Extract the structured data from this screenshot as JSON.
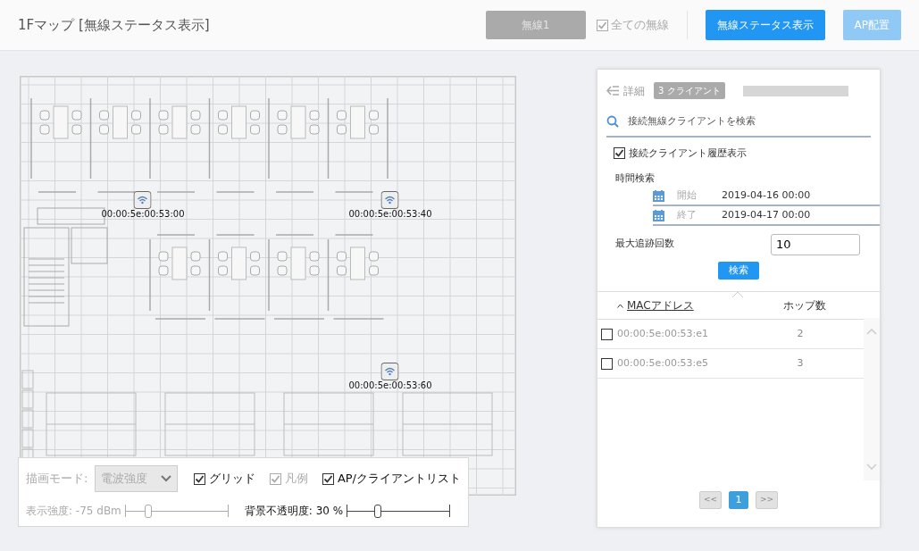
{
  "header": {
    "title": "1Fマップ [無線ステータス表示]",
    "radio_select": {
      "label": "無線1",
      "disabled": true
    },
    "all_radios": {
      "label": "全ての無線",
      "checked": true,
      "disabled": true
    },
    "buttons": [
      {
        "label": "無線ステータス表示",
        "disabled": false
      },
      {
        "label": "AP配置",
        "disabled": true
      }
    ]
  },
  "map": {
    "access_points": [
      {
        "label": "00:00:5e:00:53:00"
      },
      {
        "label": "00:00:5e:00:53:40"
      },
      {
        "label": "00:00:5e:00:53:60"
      }
    ]
  },
  "display_options": {
    "mode_label": "描画モード:",
    "mode_value": "電波強度",
    "mode_disabled": true,
    "checkboxes": [
      {
        "label": "グリッド",
        "checked": true,
        "disabled": false
      },
      {
        "label": "凡例",
        "checked": true,
        "disabled": true
      },
      {
        "label": "AP/クライアントリスト",
        "checked": true,
        "disabled": false
      }
    ],
    "sliders": [
      {
        "label": "表示強度: -75 dBm",
        "level": 0.22,
        "disabled": true
      },
      {
        "label": "背景不透明度: 30 %",
        "level": 0.3,
        "disabled": false
      }
    ]
  },
  "detail_panel": {
    "title": "詳細",
    "client_count": "3 クライアント",
    "search_placeholder": "接続無線クライアントを検索",
    "history": {
      "label": "接続クライアント履歴表示",
      "checked": true
    },
    "time_search_label": "時間検索",
    "start": {
      "label": "開始",
      "value": "2019-04-16 00:00"
    },
    "end": {
      "label": "終了",
      "value": "2019-04-17 00:00"
    },
    "max_trace_label": "最大追跡回数",
    "max_trace_value": "10",
    "search_button": "検索",
    "table": {
      "columns": [
        {
          "label": "MACアドレス",
          "sorted": true
        },
        {
          "label": "ホップ数",
          "sorted": false
        }
      ],
      "rows": [
        {
          "mac": "00:00:5e:00:53:e1",
          "hops": "2",
          "checked": false
        },
        {
          "mac": "00:00:5e:00:53:e5",
          "hops": "3",
          "checked": false
        }
      ]
    },
    "pagination": {
      "prev": "<<",
      "pages": [
        {
          "label": "1",
          "selected": true
        }
      ],
      "next": ">>"
    }
  }
}
